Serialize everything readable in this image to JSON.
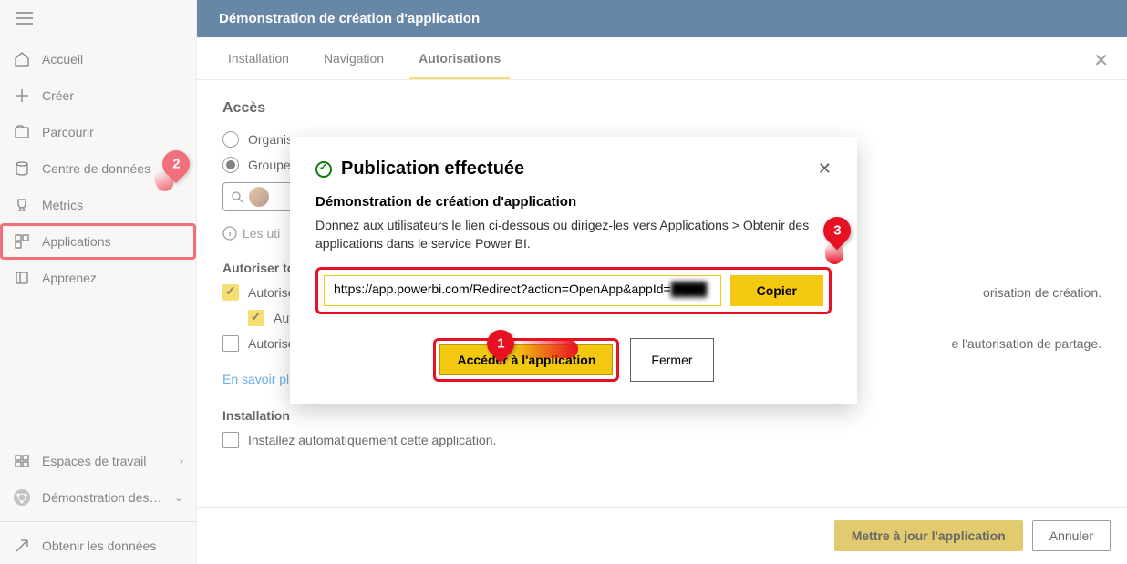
{
  "sidebar": {
    "items": [
      {
        "label": "Accueil",
        "icon": "home"
      },
      {
        "label": "Créer",
        "icon": "plus"
      },
      {
        "label": "Parcourir",
        "icon": "browse"
      },
      {
        "label": "Centre de données",
        "icon": "data"
      },
      {
        "label": "Metrics",
        "icon": "trophy"
      },
      {
        "label": "Applications",
        "icon": "apps"
      },
      {
        "label": "Apprenez",
        "icon": "learn"
      }
    ],
    "bottom": [
      {
        "label": "Espaces de travail",
        "icon": "workspaces",
        "chev": "›"
      },
      {
        "label": "Démonstration des…",
        "icon": "demo",
        "chev": "⌄"
      }
    ],
    "footer": {
      "label": "Obtenir les données",
      "icon": "get-data"
    }
  },
  "header": {
    "title": "Démonstration de création d'application"
  },
  "tabs": {
    "t1": "Installation",
    "t2": "Navigation",
    "t3": "Autorisations"
  },
  "content": {
    "access_title": "Accès",
    "radio1": "Organis",
    "radio2": "Groupe",
    "info": "Les uti",
    "auth_title": "Autoriser to",
    "chk1": "Autorise",
    "chk2": "Aut",
    "chk1_tail": "orisation de création.",
    "chk3": "Autorise",
    "chk3_tail": "e l'autorisation de partage.",
    "link": "En savoir plus sur la publication et la mise à jour des applications Power BI",
    "install_title": "Installation",
    "chk4": "Installez automatiquement cette application."
  },
  "footer": {
    "update": "Mettre à jour l'application",
    "cancel": "Annuler"
  },
  "modal": {
    "title": "Publication effectuée",
    "subtitle": "Démonstration de création d'application",
    "desc": "Donnez aux utilisateurs le lien ci-dessous ou dirigez-les vers Applications > Obtenir des applications dans le service Power BI.",
    "url_prefix": "https://app.powerbi.com/Redirect?action=OpenApp&appId=",
    "url_blur": "████",
    "copy": "Copier",
    "access": "Accéder à l'application",
    "close": "Fermer"
  },
  "annotations": {
    "b1": "1",
    "b2": "2",
    "b3": "3"
  }
}
